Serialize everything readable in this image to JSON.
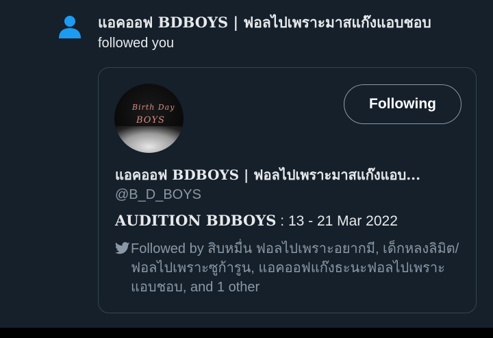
{
  "notification": {
    "actor_name": "แอคออฟ BDBOYS | ฟอลไปเพราะมาสแก๊งแอบชอบ",
    "action": "followed you"
  },
  "card": {
    "avatar_text_line1": "Birth Day",
    "avatar_text_line2": "BOYS",
    "follow_button_label": "Following",
    "display_name": "แอคออฟ BDBOYS | ฟอลไปเพราะมาสแก๊งแอบ...",
    "handle": "@B_D_BOYS",
    "bio_bold": "AUDITION BDBOYS",
    "bio_rest": " : 13 - 21 Mar 2022",
    "followed_by_text": "Followed by สิบหมื่น ฟอลไปเพราะอยากมี, เด็กหลงลิมิต/ฟอลไปเพราะซูก้ารูน, แอคออฟแก๊งธะนะฟอลไปเพราะแอบชอบ, and 1 other"
  },
  "icons": {
    "person": "person-icon",
    "bird": "twitter-bird-icon"
  },
  "colors": {
    "background": "#15202b",
    "accent_blue": "#1d9bf0",
    "secondary_text": "#8b98a5",
    "border": "#38444d"
  }
}
